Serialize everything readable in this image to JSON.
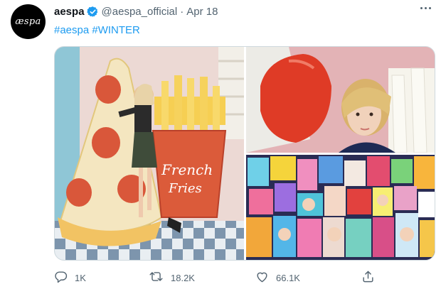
{
  "tweet": {
    "avatar_text": "æspa",
    "display_name": "aespa",
    "handle": "@aespa_official",
    "separator": "·",
    "date": "Apr 18",
    "hashtags": [
      "#aespa",
      "#WINTER"
    ]
  },
  "media": {
    "photo_1_text": [
      "French",
      "Fries"
    ]
  },
  "actions": {
    "reply_count": "1K",
    "retweet_count": "18.2K",
    "like_count": "66.1K"
  },
  "icons": {
    "verified": "verified-badge-icon",
    "more": "more-options-icon",
    "reply": "reply-icon",
    "retweet": "retweet-icon",
    "like": "like-icon",
    "share": "share-icon"
  },
  "colors": {
    "accent": "#1d9bf0",
    "muted": "#536471",
    "text": "#0f1419"
  }
}
